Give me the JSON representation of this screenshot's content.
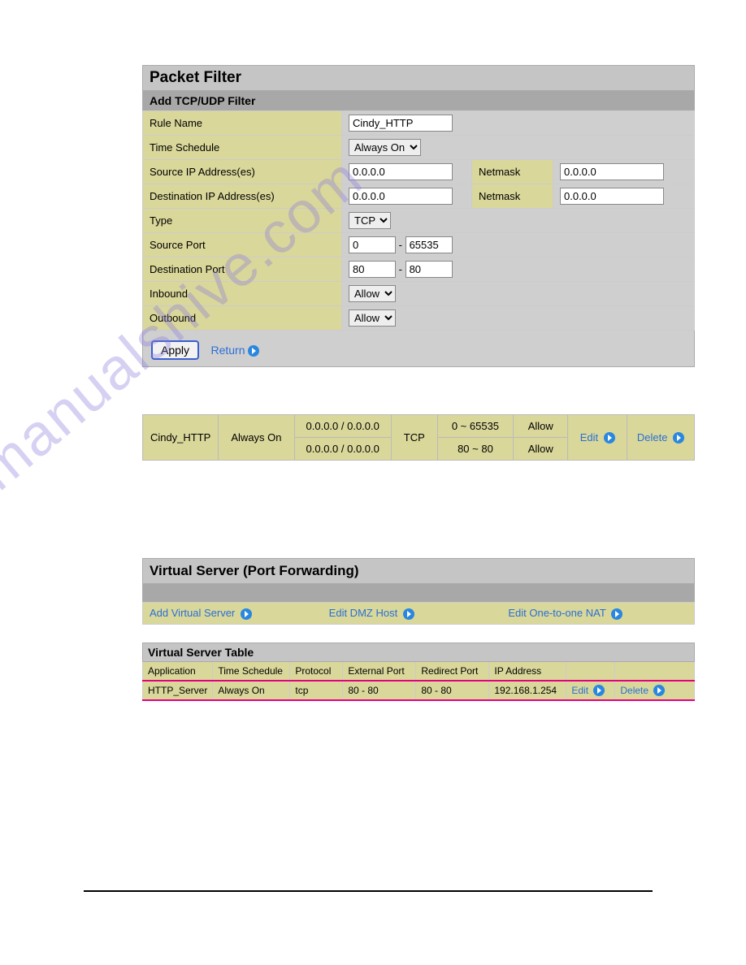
{
  "section1": {
    "title": "Packet Filter",
    "subtitle": "Add TCP/UDP Filter",
    "labels": {
      "rule_name": "Rule Name",
      "time_schedule": "Time Schedule",
      "src_ip": "Source IP Address(es)",
      "dst_ip": "Destination IP Address(es)",
      "netmask": "Netmask",
      "type": "Type",
      "src_port": "Source Port",
      "dst_port": "Destination Port",
      "inbound": "Inbound",
      "outbound": "Outbound"
    },
    "values": {
      "rule_name": "Cindy_HTTP",
      "time_schedule": "Always On",
      "src_ip": "0.0.0.0",
      "src_netmask": "0.0.0.0",
      "dst_ip": "0.0.0.0",
      "dst_netmask": "0.0.0.0",
      "type": "TCP",
      "src_port_from": "0",
      "src_port_to": "65535",
      "dst_port_from": "80",
      "dst_port_to": "80",
      "inbound": "Allow",
      "outbound": "Allow"
    },
    "apply": "Apply",
    "return": "Return"
  },
  "rule_row": {
    "name": "Cindy_HTTP",
    "schedule": "Always On",
    "src": "0.0.0.0 / 0.0.0.0",
    "dst": "0.0.0.0 / 0.0.0.0",
    "proto": "TCP",
    "src_port": "0 ~ 65535",
    "dst_port": "80 ~ 80",
    "inbound": "Allow",
    "outbound": "Allow",
    "edit": "Edit",
    "delete": "Delete"
  },
  "vs": {
    "title": "Virtual Server (Port Forwarding)",
    "links": {
      "add": "Add Virtual Server",
      "dmz": "Edit DMZ Host",
      "nat": "Edit One-to-one NAT"
    },
    "table_title": "Virtual Server Table",
    "headers": {
      "app": "Application",
      "schedule": "Time Schedule",
      "proto": "Protocol",
      "ext": "External Port",
      "redir": "Redirect Port",
      "ip": "IP Address"
    },
    "row": {
      "app": "HTTP_Server",
      "schedule": "Always On",
      "proto": "tcp",
      "ext": "80 - 80",
      "redir": "80 - 80",
      "ip": "192.168.1.254",
      "edit": "Edit",
      "delete": "Delete"
    }
  },
  "watermark": "manualshive.com"
}
